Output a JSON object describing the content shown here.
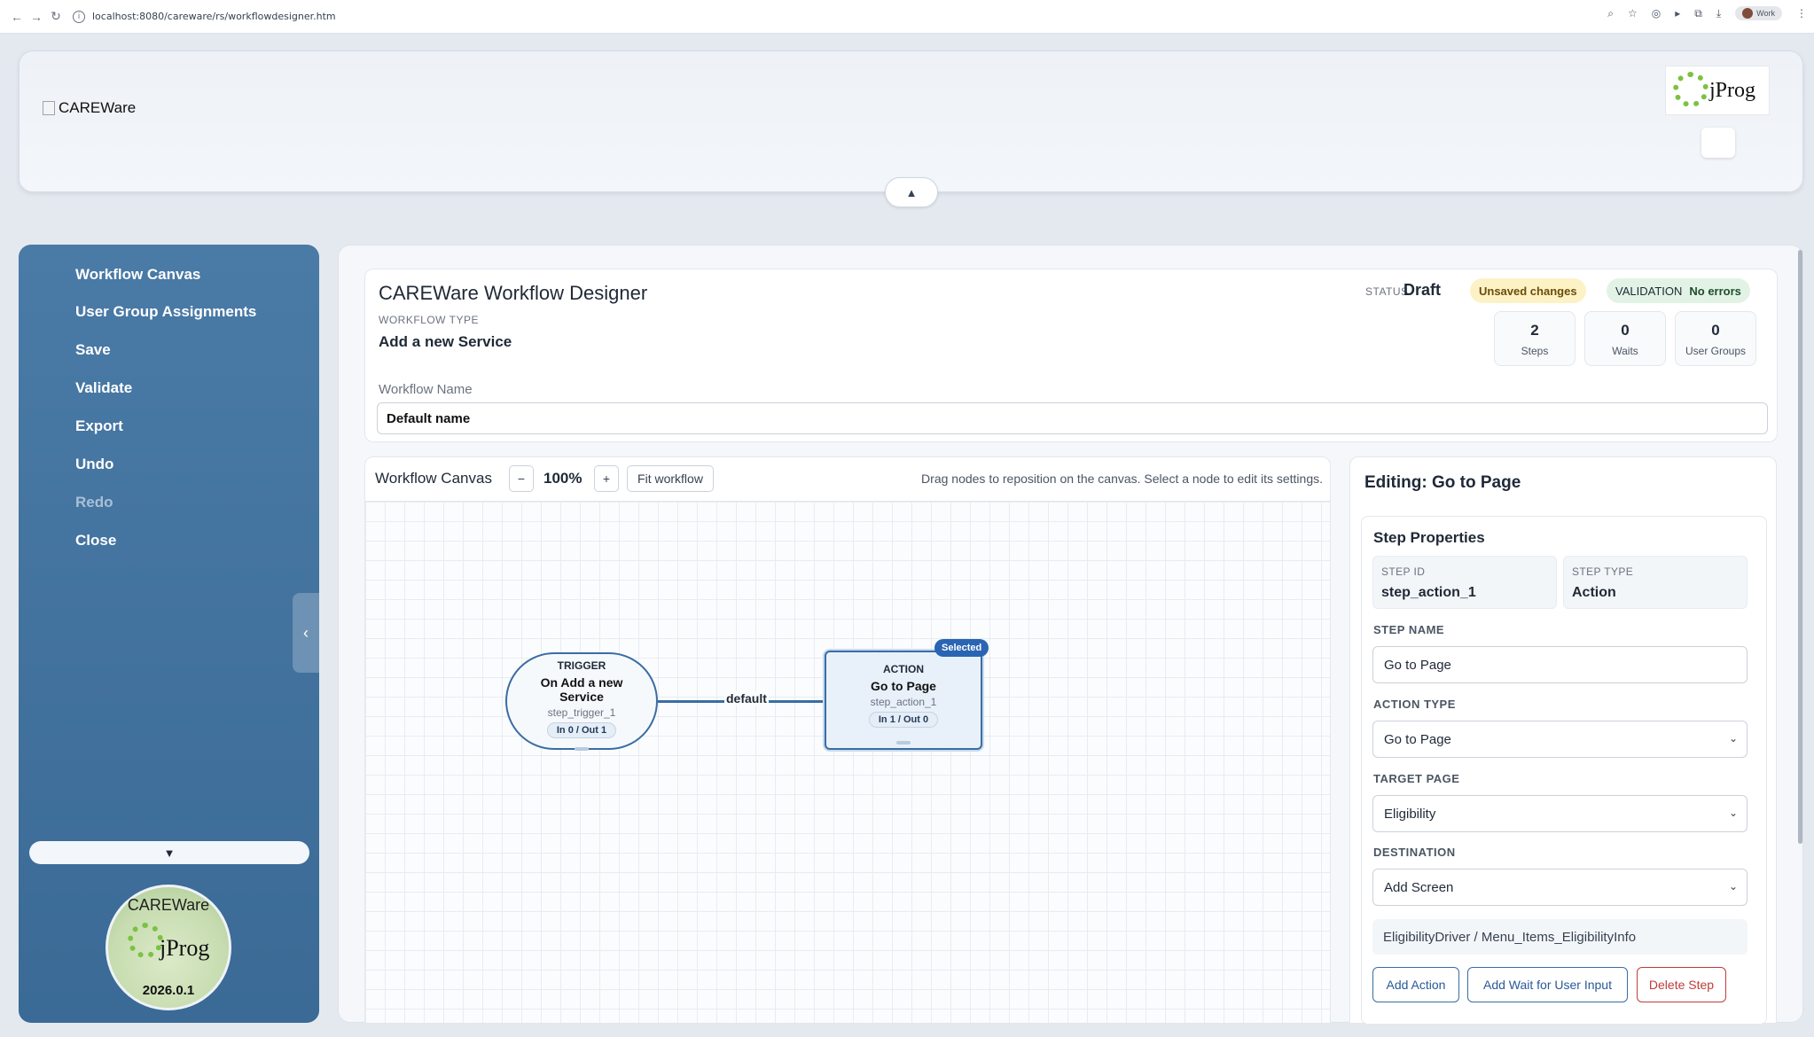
{
  "browser": {
    "url": "localhost:8080/careware/rs/workflowdesigner.htm",
    "profile_label": "Work"
  },
  "header": {
    "logo_alt": "CAREWare",
    "brand": "jProg",
    "collapse_glyph": "▲"
  },
  "sidebar": {
    "items": [
      {
        "label": "Workflow Canvas"
      },
      {
        "label": "User Group Assignments"
      },
      {
        "label": "Save"
      },
      {
        "label": "Validate"
      },
      {
        "label": "Export"
      },
      {
        "label": "Undo"
      },
      {
        "label": "Redo",
        "disabled": true
      },
      {
        "label": "Close"
      }
    ],
    "collapse_glyph": "‹",
    "expand_glyph": "▼",
    "badge": {
      "arc_text": "CAREWare",
      "brand": "jProg",
      "version": "2026.0.1"
    }
  },
  "designer": {
    "title": "CAREWare Workflow Designer",
    "workflow_type_label": "WORKFLOW TYPE",
    "workflow_type": "Add a new Service",
    "status_label": "STATUS",
    "status": "Draft",
    "unsaved": "Unsaved changes",
    "validation_label": "VALIDATION",
    "validation": "No errors",
    "stats": [
      {
        "value": "2",
        "label": "Steps"
      },
      {
        "value": "0",
        "label": "Waits"
      },
      {
        "value": "0",
        "label": "User Groups"
      }
    ],
    "name_label": "Workflow Name",
    "name_value": "Default name"
  },
  "canvas": {
    "title": "Workflow Canvas",
    "zoom_out": "−",
    "zoom": "100%",
    "zoom_in": "+",
    "fit": "Fit workflow",
    "hint": "Drag nodes to reposition on the canvas. Select a node to edit its settings.",
    "trigger": {
      "kind": "TRIGGER",
      "title": "On Add a new Service",
      "id": "step_trigger_1",
      "io": "In 0 / Out 1"
    },
    "action": {
      "kind": "ACTION",
      "title": "Go to Page",
      "id": "step_action_1",
      "io": "In 1 / Out 0",
      "badge": "Selected"
    },
    "edge_label": "default"
  },
  "properties": {
    "title": "Editing: Go to Page",
    "section": "Step Properties",
    "step_id_label": "STEP ID",
    "step_id": "step_action_1",
    "step_type_label": "STEP TYPE",
    "step_type": "Action",
    "step_name_label": "STEP NAME",
    "step_name": "Go to Page",
    "action_type_label": "ACTION TYPE",
    "action_type": "Go to Page",
    "target_page_label": "TARGET PAGE",
    "target_page": "Eligibility",
    "destination_label": "DESTINATION",
    "destination": "Add Screen",
    "path": "EligibilityDriver / Menu_Items_EligibilityInfo",
    "buttons": {
      "add_action": "Add Action",
      "add_wait": "Add Wait for User Input",
      "delete": "Delete Step"
    }
  }
}
